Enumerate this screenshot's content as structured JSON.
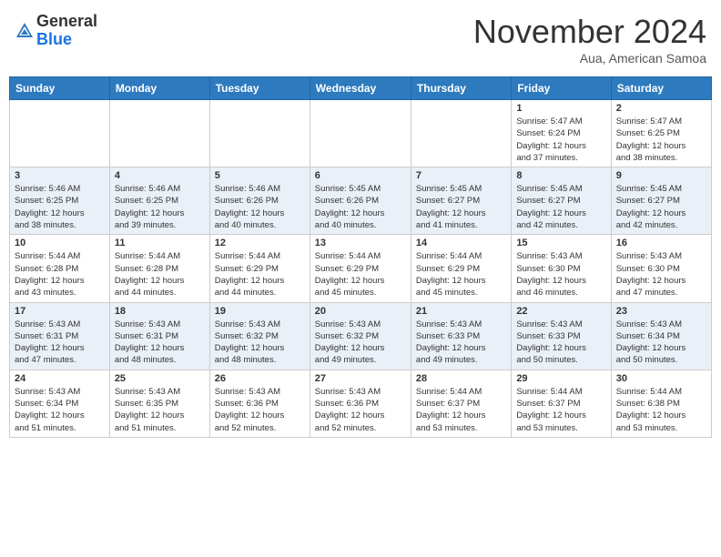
{
  "header": {
    "logo": {
      "line1": "General",
      "line2": "Blue"
    },
    "month": "November 2024",
    "location": "Aua, American Samoa"
  },
  "weekdays": [
    "Sunday",
    "Monday",
    "Tuesday",
    "Wednesday",
    "Thursday",
    "Friday",
    "Saturday"
  ],
  "weeks": [
    [
      {
        "day": "",
        "info": ""
      },
      {
        "day": "",
        "info": ""
      },
      {
        "day": "",
        "info": ""
      },
      {
        "day": "",
        "info": ""
      },
      {
        "day": "",
        "info": ""
      },
      {
        "day": "1",
        "info": "Sunrise: 5:47 AM\nSunset: 6:24 PM\nDaylight: 12 hours\nand 37 minutes."
      },
      {
        "day": "2",
        "info": "Sunrise: 5:47 AM\nSunset: 6:25 PM\nDaylight: 12 hours\nand 38 minutes."
      }
    ],
    [
      {
        "day": "3",
        "info": "Sunrise: 5:46 AM\nSunset: 6:25 PM\nDaylight: 12 hours\nand 38 minutes."
      },
      {
        "day": "4",
        "info": "Sunrise: 5:46 AM\nSunset: 6:25 PM\nDaylight: 12 hours\nand 39 minutes."
      },
      {
        "day": "5",
        "info": "Sunrise: 5:46 AM\nSunset: 6:26 PM\nDaylight: 12 hours\nand 40 minutes."
      },
      {
        "day": "6",
        "info": "Sunrise: 5:45 AM\nSunset: 6:26 PM\nDaylight: 12 hours\nand 40 minutes."
      },
      {
        "day": "7",
        "info": "Sunrise: 5:45 AM\nSunset: 6:27 PM\nDaylight: 12 hours\nand 41 minutes."
      },
      {
        "day": "8",
        "info": "Sunrise: 5:45 AM\nSunset: 6:27 PM\nDaylight: 12 hours\nand 42 minutes."
      },
      {
        "day": "9",
        "info": "Sunrise: 5:45 AM\nSunset: 6:27 PM\nDaylight: 12 hours\nand 42 minutes."
      }
    ],
    [
      {
        "day": "10",
        "info": "Sunrise: 5:44 AM\nSunset: 6:28 PM\nDaylight: 12 hours\nand 43 minutes."
      },
      {
        "day": "11",
        "info": "Sunrise: 5:44 AM\nSunset: 6:28 PM\nDaylight: 12 hours\nand 44 minutes."
      },
      {
        "day": "12",
        "info": "Sunrise: 5:44 AM\nSunset: 6:29 PM\nDaylight: 12 hours\nand 44 minutes."
      },
      {
        "day": "13",
        "info": "Sunrise: 5:44 AM\nSunset: 6:29 PM\nDaylight: 12 hours\nand 45 minutes."
      },
      {
        "day": "14",
        "info": "Sunrise: 5:44 AM\nSunset: 6:29 PM\nDaylight: 12 hours\nand 45 minutes."
      },
      {
        "day": "15",
        "info": "Sunrise: 5:43 AM\nSunset: 6:30 PM\nDaylight: 12 hours\nand 46 minutes."
      },
      {
        "day": "16",
        "info": "Sunrise: 5:43 AM\nSunset: 6:30 PM\nDaylight: 12 hours\nand 47 minutes."
      }
    ],
    [
      {
        "day": "17",
        "info": "Sunrise: 5:43 AM\nSunset: 6:31 PM\nDaylight: 12 hours\nand 47 minutes."
      },
      {
        "day": "18",
        "info": "Sunrise: 5:43 AM\nSunset: 6:31 PM\nDaylight: 12 hours\nand 48 minutes."
      },
      {
        "day": "19",
        "info": "Sunrise: 5:43 AM\nSunset: 6:32 PM\nDaylight: 12 hours\nand 48 minutes."
      },
      {
        "day": "20",
        "info": "Sunrise: 5:43 AM\nSunset: 6:32 PM\nDaylight: 12 hours\nand 49 minutes."
      },
      {
        "day": "21",
        "info": "Sunrise: 5:43 AM\nSunset: 6:33 PM\nDaylight: 12 hours\nand 49 minutes."
      },
      {
        "day": "22",
        "info": "Sunrise: 5:43 AM\nSunset: 6:33 PM\nDaylight: 12 hours\nand 50 minutes."
      },
      {
        "day": "23",
        "info": "Sunrise: 5:43 AM\nSunset: 6:34 PM\nDaylight: 12 hours\nand 50 minutes."
      }
    ],
    [
      {
        "day": "24",
        "info": "Sunrise: 5:43 AM\nSunset: 6:34 PM\nDaylight: 12 hours\nand 51 minutes."
      },
      {
        "day": "25",
        "info": "Sunrise: 5:43 AM\nSunset: 6:35 PM\nDaylight: 12 hours\nand 51 minutes."
      },
      {
        "day": "26",
        "info": "Sunrise: 5:43 AM\nSunset: 6:36 PM\nDaylight: 12 hours\nand 52 minutes."
      },
      {
        "day": "27",
        "info": "Sunrise: 5:43 AM\nSunset: 6:36 PM\nDaylight: 12 hours\nand 52 minutes."
      },
      {
        "day": "28",
        "info": "Sunrise: 5:44 AM\nSunset: 6:37 PM\nDaylight: 12 hours\nand 53 minutes."
      },
      {
        "day": "29",
        "info": "Sunrise: 5:44 AM\nSunset: 6:37 PM\nDaylight: 12 hours\nand 53 minutes."
      },
      {
        "day": "30",
        "info": "Sunrise: 5:44 AM\nSunset: 6:38 PM\nDaylight: 12 hours\nand 53 minutes."
      }
    ]
  ]
}
